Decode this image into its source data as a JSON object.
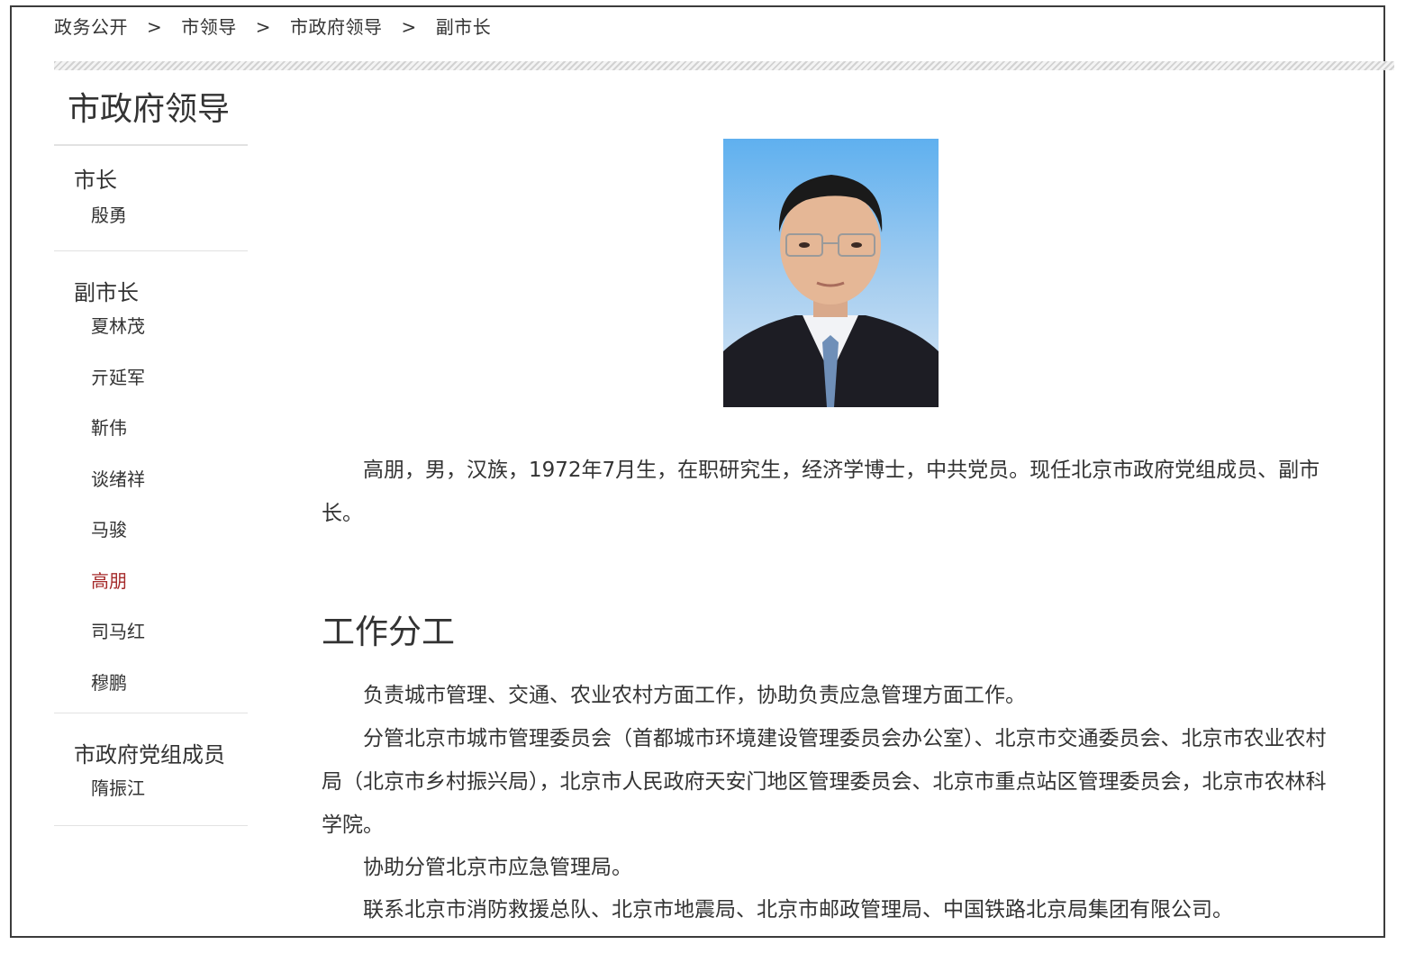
{
  "breadcrumb": {
    "items": [
      "政务公开",
      "市领导",
      "市政府领导",
      "副市长"
    ],
    "separator": ">"
  },
  "sidebar": {
    "title": "市政府领导",
    "groups": [
      {
        "title": "市长",
        "items": [
          "殷勇"
        ]
      },
      {
        "title": "副市长",
        "items": [
          "夏林茂",
          "亓延军",
          "靳伟",
          "谈绪祥",
          "马骏",
          "高朋",
          "司马红",
          "穆鹏"
        ]
      },
      {
        "title": "市政府党组成员",
        "items": [
          "隋振江"
        ]
      }
    ],
    "active_item": "高朋",
    "active_color": "#a52a2a"
  },
  "main": {
    "portrait_icon": "person-portrait",
    "bio": "高朋，男，汉族，1972年7月生，在职研究生，经济学博士，中共党员。现任北京市政府党组成员、副市长。",
    "section_title": "工作分工",
    "duties": [
      "负责城市管理、交通、农业农村方面工作，协助负责应急管理方面工作。",
      "分管北京市城市管理委员会（首都城市环境建设管理委员会办公室）、北京市交通委员会、北京市农业农村局（北京市乡村振兴局），北京市人民政府天安门地区管理委员会、北京市重点站区管理委员会，北京市农林科学院。",
      "协助分管北京市应急管理局。",
      "联系北京市消防救援总队、北京市地震局、北京市邮政管理局、中国铁路北京局集团有限公司。"
    ]
  }
}
